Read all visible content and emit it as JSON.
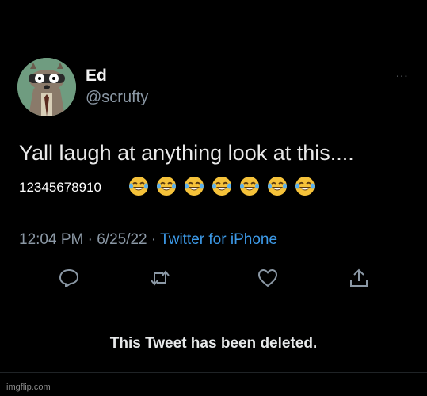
{
  "author": {
    "name": "Ed",
    "handle": "@scrufty"
  },
  "more_menu": {
    "label": "..."
  },
  "tweet": {
    "text": "Yall laugh at anything look at this....",
    "numbers": "12345678910",
    "emoji_icons": [
      "face-with-tears-of-joy-icon",
      "face-with-tears-of-joy-icon",
      "face-with-tears-of-joy-icon",
      "face-with-tears-of-joy-icon",
      "face-with-tears-of-joy-icon",
      "face-with-tears-of-joy-icon",
      "face-with-tears-of-joy-icon"
    ]
  },
  "meta": {
    "time": "12:04 PM",
    "sep1": " · ",
    "date": "6/25/22",
    "sep2": " · ",
    "source": "Twitter for iPhone"
  },
  "actions": [
    "reply-icon",
    "retweet-icon",
    "like-icon",
    "share-icon"
  ],
  "status": "This Tweet has been deleted.",
  "watermark": "imgflip.com",
  "colors": {
    "background": "#000000",
    "text": "#e7e9ea",
    "muted": "#8b98a5",
    "link": "#3d9ae8",
    "emoji": "#f5c23a"
  }
}
